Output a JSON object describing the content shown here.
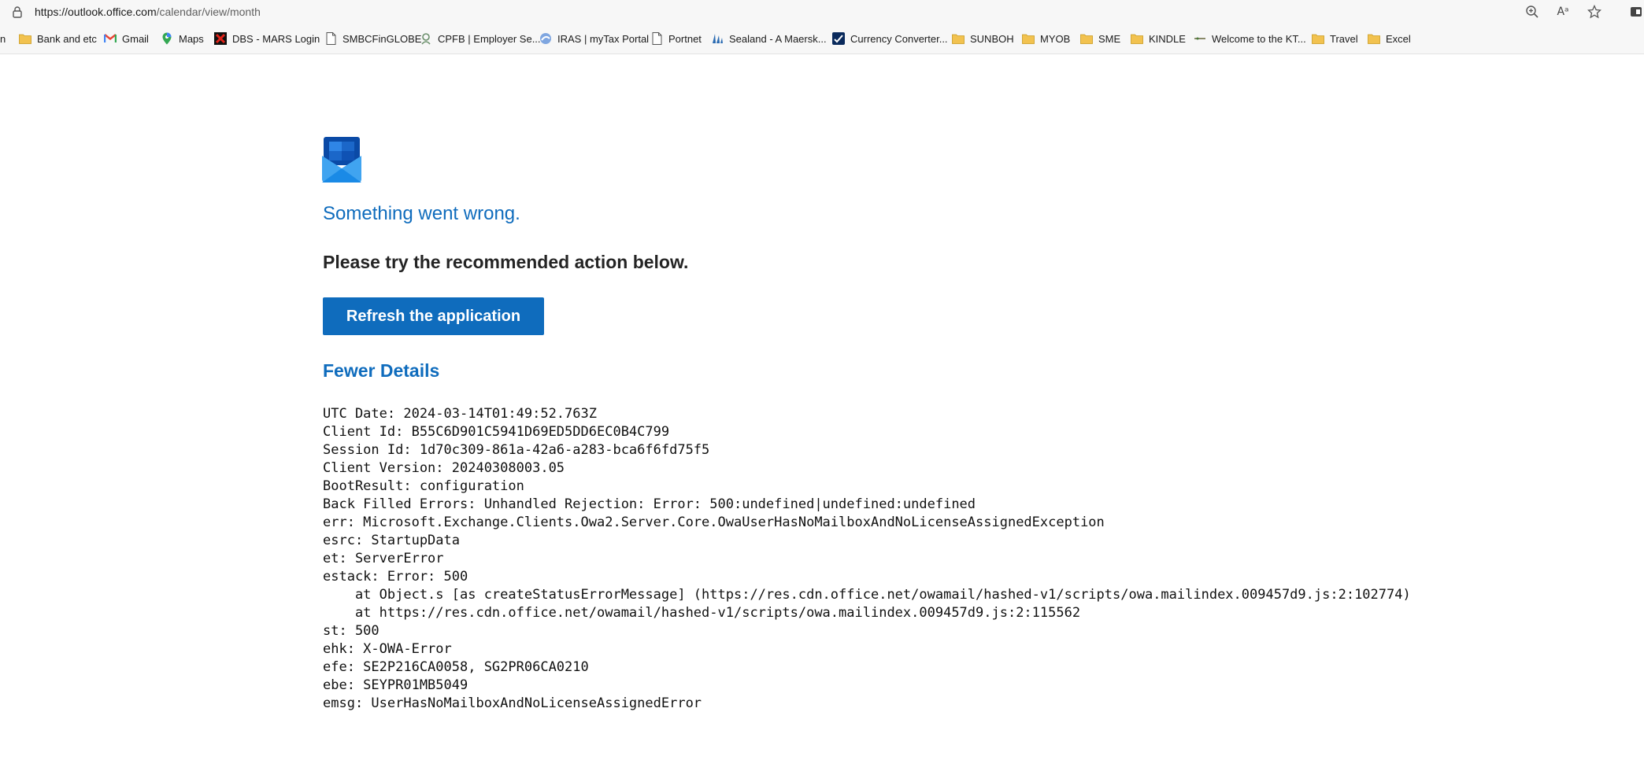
{
  "browser": {
    "url_host": "https://outlook.office.com",
    "url_path": "/calendar/view/month",
    "icons": {
      "lock": "lock-icon",
      "zoom": "zoom-icon",
      "read_aloud": "read-aloud-icon",
      "favorite": "star-icon"
    },
    "read_aloud_text": "Aᵃ"
  },
  "favorites": [
    {
      "label": "n",
      "icon": "none"
    },
    {
      "label": "Bank and etc",
      "icon": "folder-icon"
    },
    {
      "label": "Gmail",
      "icon": "gmail-icon"
    },
    {
      "label": "Maps",
      "icon": "maps-pin-icon"
    },
    {
      "label": "DBS - MARS Login",
      "icon": "dbs-icon"
    },
    {
      "label": "SMBCFinGLOBE",
      "icon": "page-icon"
    },
    {
      "label": "CPFB | Employer Se...",
      "icon": "cpfb-icon"
    },
    {
      "label": "IRAS | myTax Portal",
      "icon": "iras-icon"
    },
    {
      "label": "Portnet",
      "icon": "page-icon"
    },
    {
      "label": "Sealand - A Maersk...",
      "icon": "sealand-icon"
    },
    {
      "label": "Currency Converter...",
      "icon": "currency-icon"
    },
    {
      "label": "SUNBOH",
      "icon": "folder-icon"
    },
    {
      "label": "MYOB",
      "icon": "folder-icon"
    },
    {
      "label": "SME",
      "icon": "folder-icon"
    },
    {
      "label": "KINDLE",
      "icon": "folder-icon"
    },
    {
      "label": "Welcome to the KT...",
      "icon": "kt-icon"
    },
    {
      "label": "Travel",
      "icon": "folder-icon"
    },
    {
      "label": "Excel",
      "icon": "folder-icon"
    }
  ],
  "error_page": {
    "logo_icon": "outlook-logo-icon",
    "title": "Something went wrong.",
    "subtitle": "Please try the recommended action below.",
    "refresh_label": "Refresh the application",
    "details_toggle": "Fewer Details",
    "details_lines": [
      "UTC Date: 2024-03-14T01:49:52.763Z",
      "Client Id: B55C6D901C5941D69ED5DD6EC0B4C799",
      "Session Id: 1d70c309-861a-42a6-a283-bca6f6fd75f5",
      "Client Version: 20240308003.05",
      "BootResult: configuration",
      "Back Filled Errors: Unhandled Rejection: Error: 500:undefined|undefined:undefined",
      "err: Microsoft.Exchange.Clients.Owa2.Server.Core.OwaUserHasNoMailboxAndNoLicenseAssignedException",
      "esrc: StartupData",
      "et: ServerError",
      "estack: Error: 500",
      "    at Object.s [as createStatusErrorMessage] (https://res.cdn.office.net/owamail/hashed-v1/scripts/owa.mailindex.009457d9.js:2:102774)",
      "    at https://res.cdn.office.net/owamail/hashed-v1/scripts/owa.mailindex.009457d9.js:2:115562",
      "st: 500",
      "ehk: X-OWA-Error",
      "efe: SE2P216CA0058, SG2PR06CA0210",
      "ebe: SEYPR01MB5049",
      "emsg: UserHasNoMailboxAndNoLicenseAssignedError"
    ]
  },
  "colors": {
    "accent": "#0f6cbd",
    "folder": "#f2c24f",
    "chrome_bg": "#f7f7f7"
  }
}
